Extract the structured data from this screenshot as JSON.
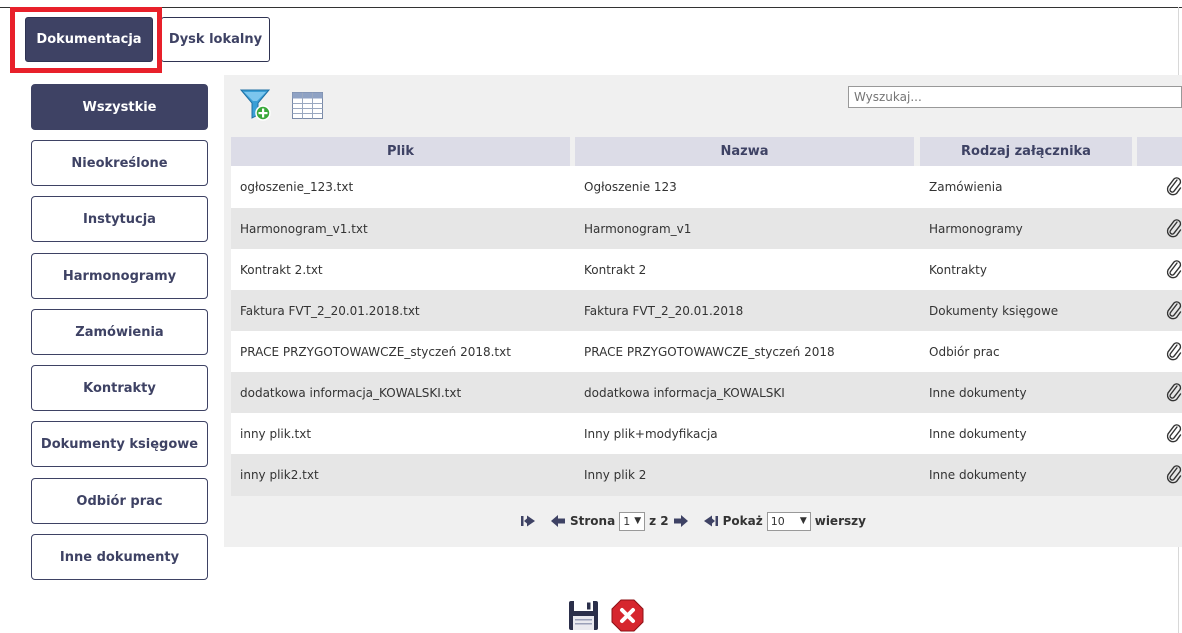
{
  "tabs": [
    {
      "label": "Dokumentacja",
      "active": true
    },
    {
      "label": "Dysk lokalny",
      "active": false
    }
  ],
  "sidebar": {
    "items": [
      {
        "label": "Wszystkie",
        "active": true
      },
      {
        "label": "Nieokreślone"
      },
      {
        "label": "Instytucja"
      },
      {
        "label": "Harmonogramy"
      },
      {
        "label": "Zamówienia"
      },
      {
        "label": "Kontrakty"
      },
      {
        "label": "Dokumenty księgowe"
      },
      {
        "label": "Odbiór prac"
      },
      {
        "label": "Inne dokumenty"
      }
    ]
  },
  "toolbar": {
    "filter_icon": "filter-add-icon",
    "columns_icon": "table-columns-icon",
    "search_placeholder": "Wyszukaj..."
  },
  "table": {
    "headers": [
      "Plik",
      "Nazwa",
      "Rodzaj załącznika"
    ],
    "rows": [
      [
        "ogłoszenie_123.txt",
        "Ogłoszenie 123",
        "Zamówienia"
      ],
      [
        "Harmonogram_v1.txt",
        "Harmonogram_v1",
        "Harmonogramy"
      ],
      [
        "Kontrakt 2.txt",
        "Kontrakt 2",
        "Kontrakty"
      ],
      [
        "Faktura FVT_2_20.01.2018.txt",
        "Faktura FVT_2_20.01.2018",
        "Dokumenty księgowe"
      ],
      [
        "PRACE PRZYGOTOWAWCZE_styczeń 2018.txt",
        "PRACE PRZYGOTOWAWCZE_styczeń 2018",
        "Odbiór prac"
      ],
      [
        "dodatkowa informacja_KOWALSKI.txt",
        "dodatkowa informacja_KOWALSKI",
        "Inne dokumenty"
      ],
      [
        "inny plik.txt",
        "Inny plik+modyfikacja",
        "Inne dokumenty"
      ],
      [
        "inny plik2.txt",
        "Inny plik 2",
        "Inne dokumenty"
      ]
    ],
    "row_icon": "paperclip-icon"
  },
  "pager": {
    "page_label": "Strona",
    "current_page": "1",
    "of_label": "z 2",
    "show_label": "Pokaż",
    "rows_per_page": "10",
    "rows_label": "wierszy"
  },
  "footer": {
    "save_icon": "floppy-disk-icon",
    "cancel_icon": "cancel-icon"
  },
  "colors": {
    "primary": "#3e4264",
    "highlight": "#e8202a",
    "header_bg": "#dcdce7",
    "row_alt": "#e6e6e6",
    "panel_bg": "#f0f0f0"
  }
}
